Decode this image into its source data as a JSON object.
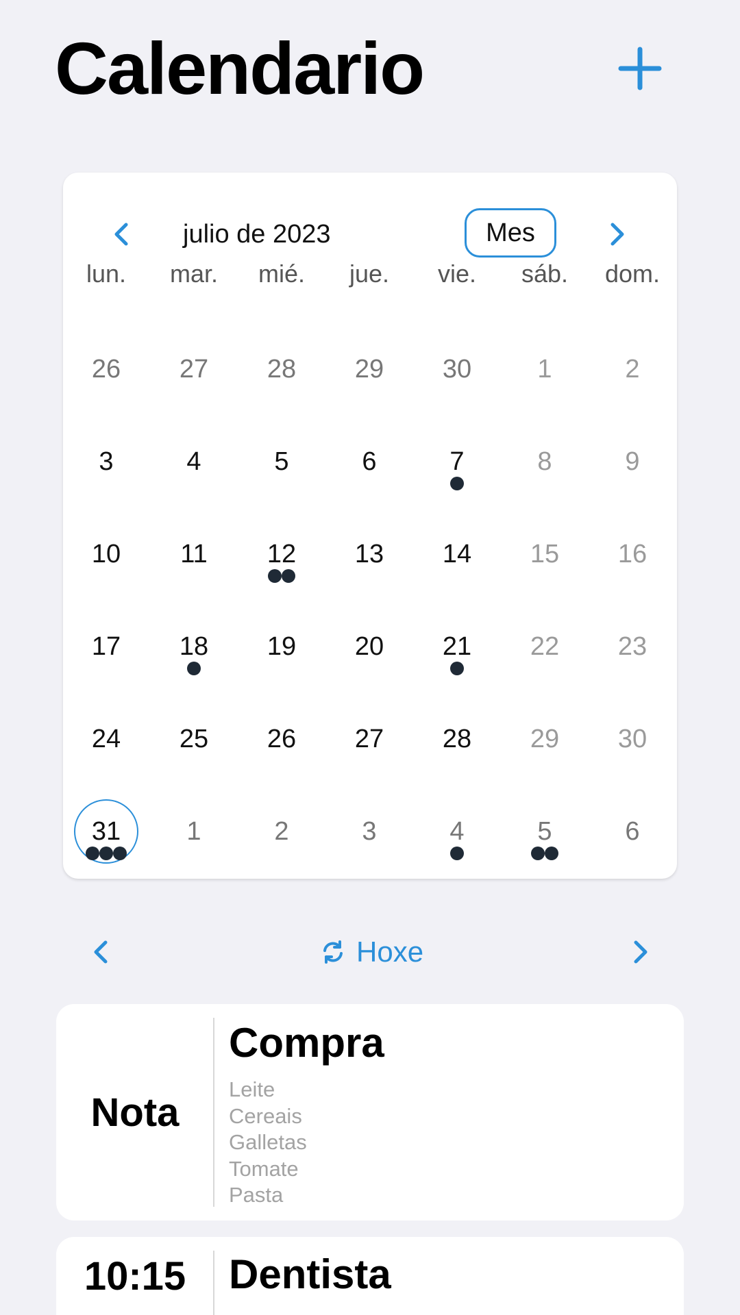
{
  "app": {
    "title": "Calendario",
    "accent_color": "#2b8fd9",
    "add_icon": "plus-icon"
  },
  "calendar": {
    "month_label": "julio de 2023",
    "view_button": "Mes",
    "prev_icon": "chevron-left-icon",
    "next_icon": "chevron-right-icon",
    "weekdays": [
      "lun.",
      "mar.",
      "mié.",
      "jue.",
      "vie.",
      "sáb.",
      "dom."
    ],
    "weeks": [
      [
        {
          "n": "26",
          "t": "outside"
        },
        {
          "n": "27",
          "t": "outside"
        },
        {
          "n": "28",
          "t": "outside"
        },
        {
          "n": "29",
          "t": "outside"
        },
        {
          "n": "30",
          "t": "outside"
        },
        {
          "n": "1",
          "t": "weekend"
        },
        {
          "n": "2",
          "t": "weekend"
        }
      ],
      [
        {
          "n": "3",
          "t": "current"
        },
        {
          "n": "4",
          "t": "current"
        },
        {
          "n": "5",
          "t": "current"
        },
        {
          "n": "6",
          "t": "current"
        },
        {
          "n": "7",
          "t": "current",
          "dots": 1
        },
        {
          "n": "8",
          "t": "weekend"
        },
        {
          "n": "9",
          "t": "weekend"
        }
      ],
      [
        {
          "n": "10",
          "t": "current"
        },
        {
          "n": "11",
          "t": "current"
        },
        {
          "n": "12",
          "t": "current",
          "dots": 2
        },
        {
          "n": "13",
          "t": "current"
        },
        {
          "n": "14",
          "t": "current"
        },
        {
          "n": "15",
          "t": "weekend"
        },
        {
          "n": "16",
          "t": "weekend"
        }
      ],
      [
        {
          "n": "17",
          "t": "current"
        },
        {
          "n": "18",
          "t": "current",
          "dots": 1
        },
        {
          "n": "19",
          "t": "current"
        },
        {
          "n": "20",
          "t": "current"
        },
        {
          "n": "21",
          "t": "current",
          "dots": 1
        },
        {
          "n": "22",
          "t": "weekend"
        },
        {
          "n": "23",
          "t": "weekend"
        }
      ],
      [
        {
          "n": "24",
          "t": "current"
        },
        {
          "n": "25",
          "t": "current"
        },
        {
          "n": "26",
          "t": "current"
        },
        {
          "n": "27",
          "t": "current"
        },
        {
          "n": "28",
          "t": "current"
        },
        {
          "n": "29",
          "t": "weekend"
        },
        {
          "n": "30",
          "t": "weekend"
        }
      ],
      [
        {
          "n": "31",
          "t": "current",
          "dots": 3,
          "today": true
        },
        {
          "n": "1",
          "t": "outside"
        },
        {
          "n": "2",
          "t": "outside"
        },
        {
          "n": "3",
          "t": "outside"
        },
        {
          "n": "4",
          "t": "outside",
          "dots": 1
        },
        {
          "n": "5",
          "t": "outside",
          "dots": 2
        },
        {
          "n": "6",
          "t": "outside"
        }
      ]
    ]
  },
  "today_bar": {
    "label": "Hoxe",
    "icon": "refresh-icon"
  },
  "events": [
    {
      "left": "Nota",
      "title": "Compra",
      "lines": [
        "Leite",
        "Cereais",
        "Galletas",
        "Tomate",
        "Pasta"
      ]
    },
    {
      "left": "10:15",
      "title": "Dentista",
      "lines": []
    }
  ]
}
